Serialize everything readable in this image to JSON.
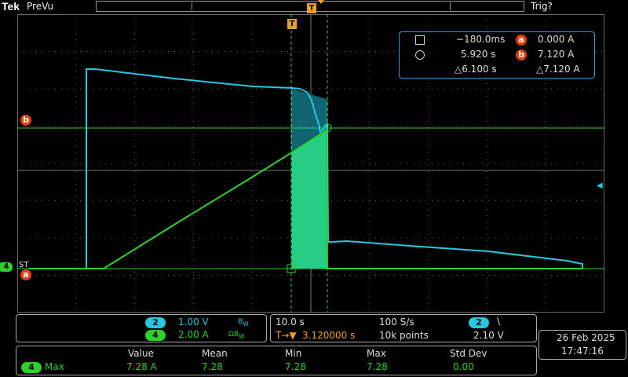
{
  "topbar": {
    "brand": "Tek",
    "mode": "PreVu",
    "trigger_status": "Trig?"
  },
  "colors": {
    "ch2": "#25c8e0",
    "ch4": "#2ad22a",
    "cursor_badge": "#e04010",
    "trigger": "#f0a020"
  },
  "markers": {
    "trigger_label": "T",
    "ch4_label": "4",
    "cursor_a": "a",
    "cursor_b": "b",
    "st": "ST"
  },
  "cursors": {
    "row1": {
      "time": "−180.0ms",
      "badge": "a",
      "value": "0.000 A"
    },
    "row2": {
      "time": "5.920 s",
      "badge": "b",
      "value": "7.120 A"
    },
    "row3": {
      "delta_time": "△6.100 s",
      "delta_value": "△7.120 A"
    }
  },
  "channels": [
    {
      "badge": "2",
      "scale": "1.00 V",
      "suffix": "B",
      "suffix_sub": "W"
    },
    {
      "badge": "4",
      "scale": "2.00 A",
      "suffix": "ΩB",
      "suffix_sub": "W"
    }
  ],
  "timebase": {
    "scale": "10.0 s",
    "sample_rate": "100 S/s",
    "trig_badge": "2",
    "trig_slope": "\\",
    "position_prefix": "T→▼",
    "position": "3.120000 s",
    "points": "10k points",
    "trig_level": "2.10 V"
  },
  "measurement": {
    "headers": [
      "Value",
      "Mean",
      "Min",
      "Max",
      "Std Dev"
    ],
    "source_badge": "4",
    "type": "Max",
    "values": [
      "7.28 A",
      "7.28",
      "7.28",
      "7.28",
      "0.00"
    ]
  },
  "datetime": {
    "date": "26 Feb  2025",
    "time": "17:47:16"
  },
  "traces": {
    "ch2": {
      "name": "",
      "points": [
        [
          0,
          0
        ],
        [
          6,
          0
        ],
        [
          6,
          70
        ],
        [
          14,
          70
        ],
        [
          28,
          72
        ],
        [
          38,
          73
        ],
        [
          44,
          74
        ],
        [
          44.5,
          20
        ],
        [
          48,
          30
        ],
        [
          48.5,
          0
        ],
        [
          100,
          0
        ]
      ]
    }
  }
}
